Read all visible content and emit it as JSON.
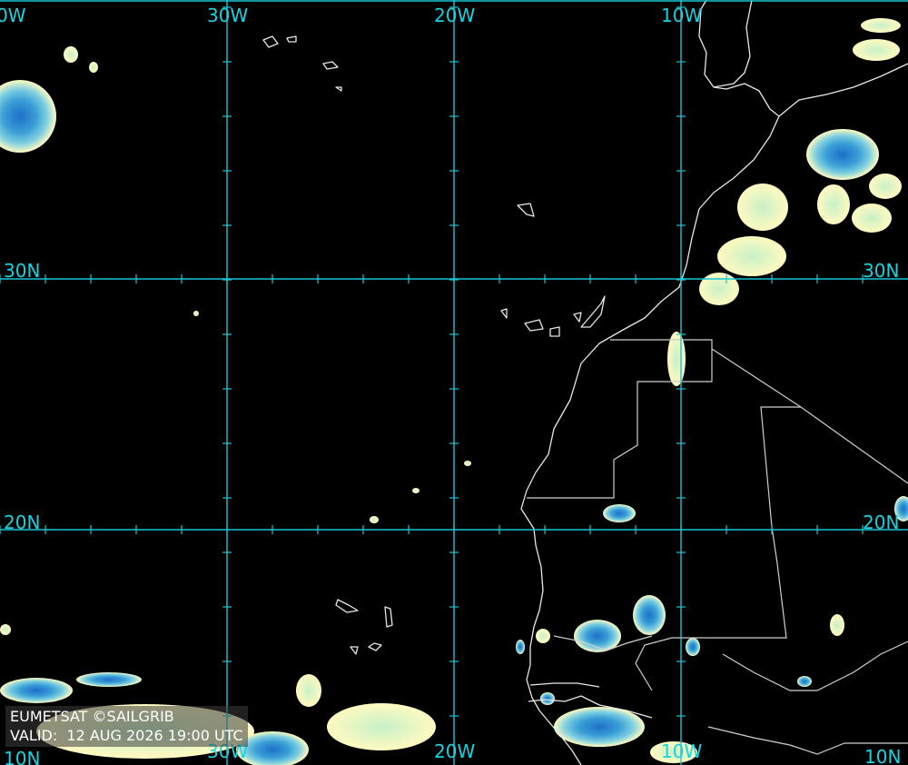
{
  "map": {
    "longitude_labels": [
      "0W",
      "30W",
      "20W",
      "10W"
    ],
    "longitude_labels_bottom": [
      "30W",
      "20W",
      "10W",
      "10N"
    ],
    "latitude_labels_left": [
      "30N",
      "20N",
      "10N"
    ],
    "latitude_labels_right": [
      "30N",
      "20N"
    ],
    "grid_color": "#19c6d6",
    "coast_color": "#e8e8e8",
    "cloud_colors": [
      "#fffac0",
      "#c8f0c8",
      "#7fd0e0",
      "#3a9fd6",
      "#1e6fc8"
    ]
  },
  "credit": {
    "line1": "EUMETSAT ©SAILGRIB",
    "line2": "VALID:  12 AUG 2026 19:00 UTC"
  }
}
